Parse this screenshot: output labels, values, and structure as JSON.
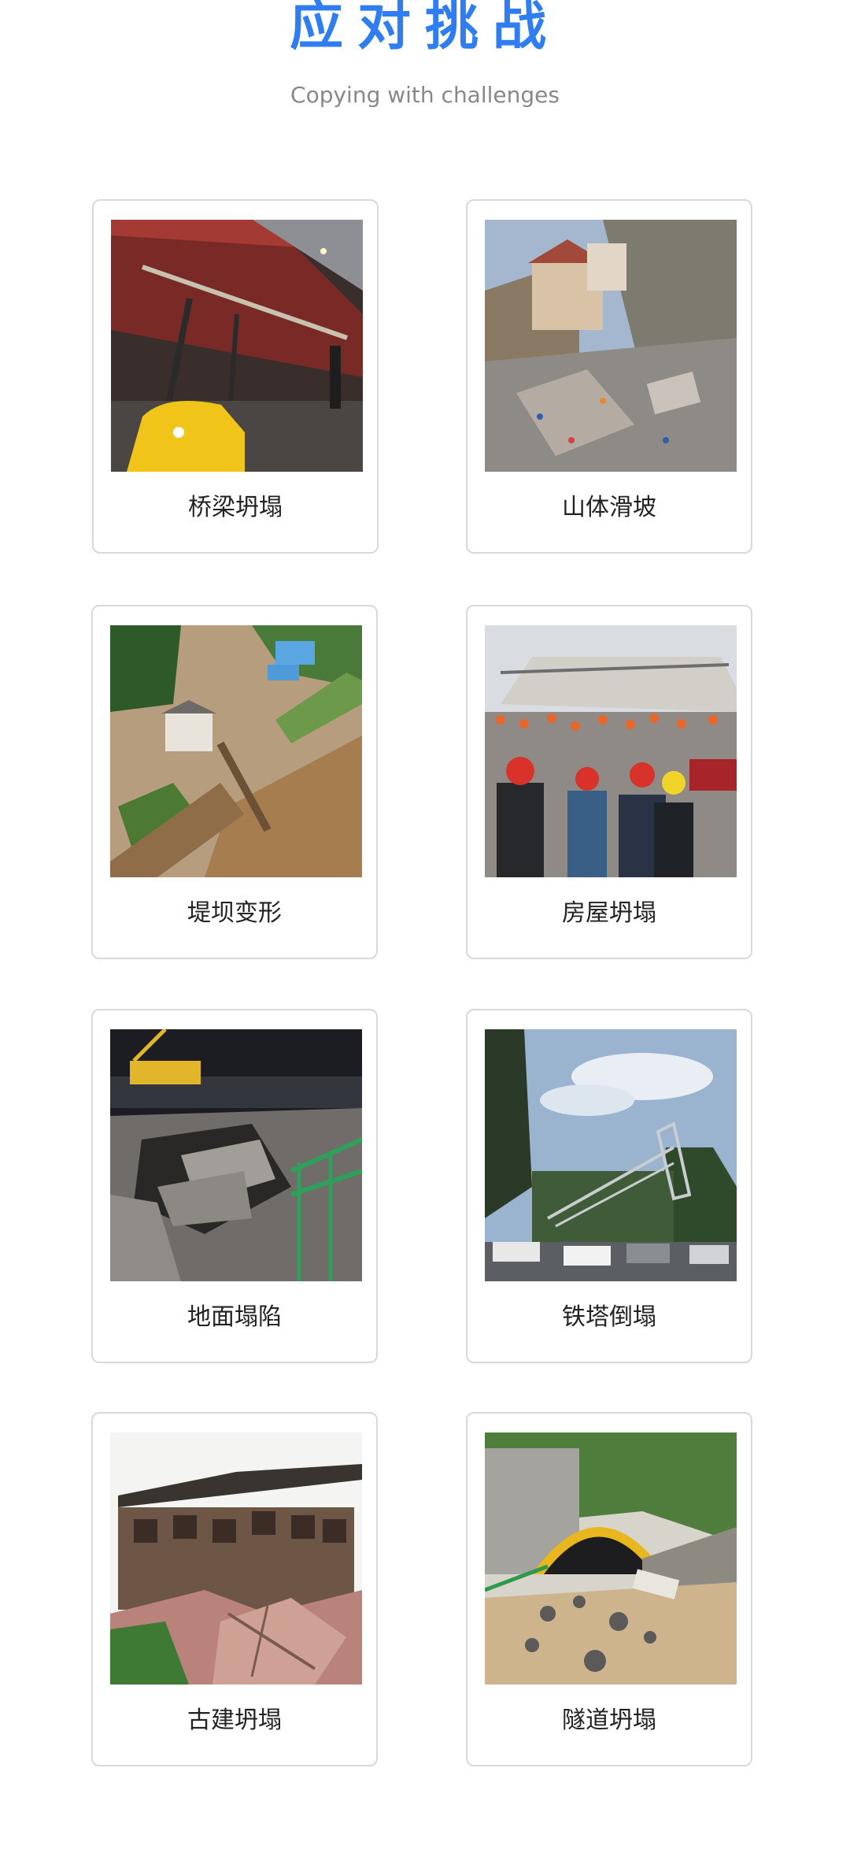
{
  "header": {
    "title": "应对挑战",
    "subtitle": "Copying with challenges"
  },
  "cards": [
    {
      "label": "桥梁坍塌"
    },
    {
      "label": "山体滑坡"
    },
    {
      "label": "堤坝变形"
    },
    {
      "label": "房屋坍塌"
    },
    {
      "label": "地面塌陷"
    },
    {
      "label": "铁塔倒塌"
    },
    {
      "label": "古建坍塌"
    },
    {
      "label": "隧道坍塌"
    }
  ],
  "colors": {
    "accent": "#2f7df0",
    "subtitle": "#888888",
    "card_border": "#d9d9d9",
    "label": "#222222"
  }
}
